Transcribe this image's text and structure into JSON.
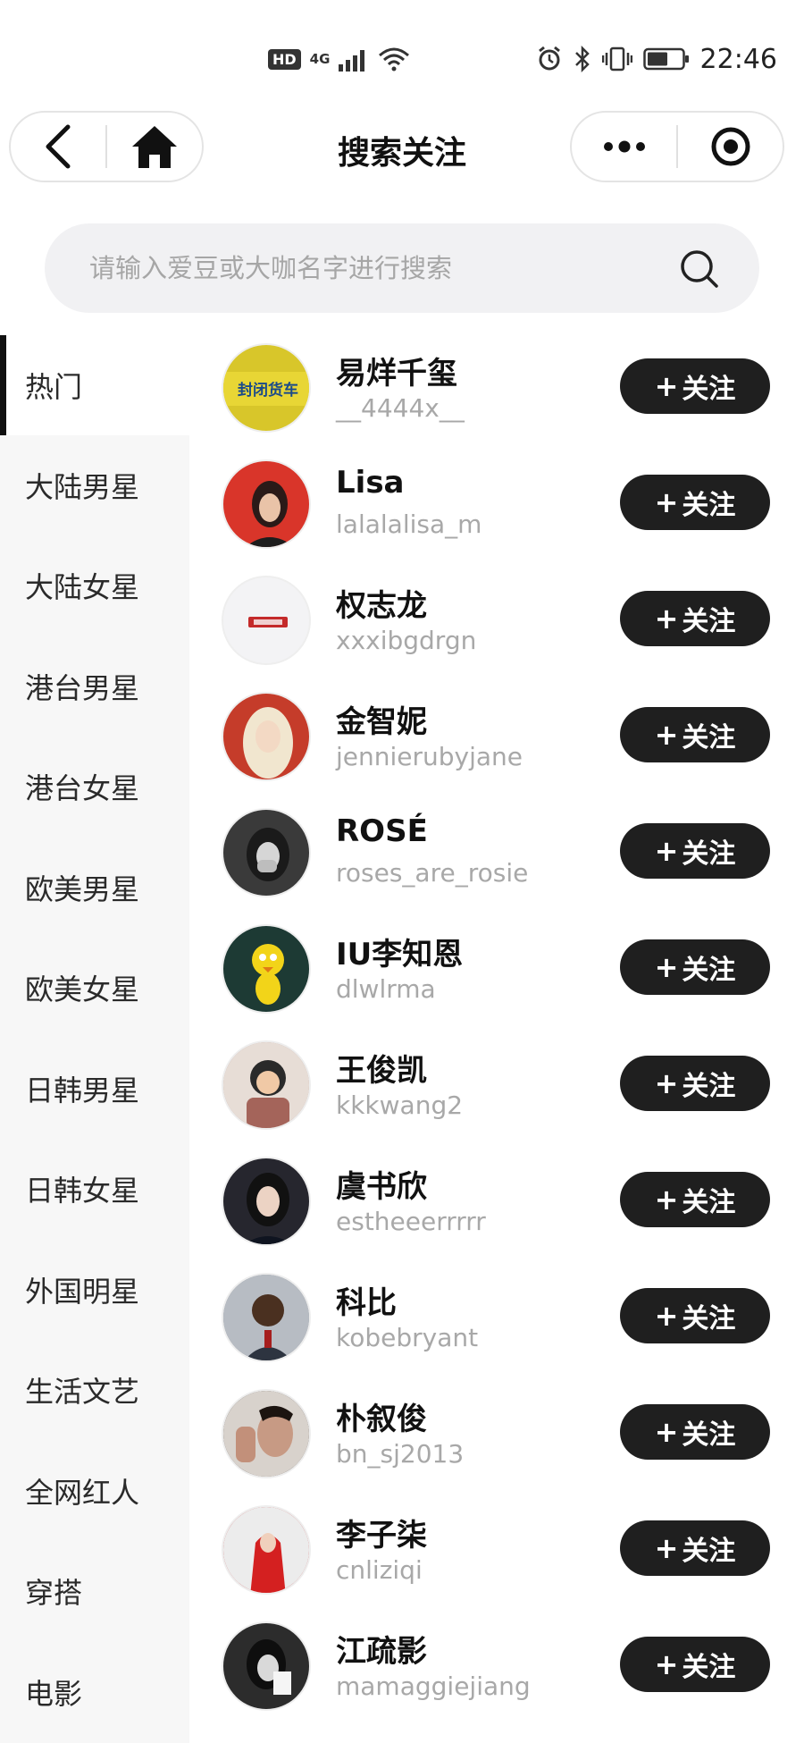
{
  "status_bar": {
    "hd": "HD",
    "network": "4G",
    "time": "22:46"
  },
  "nav": {
    "title": "搜索关注"
  },
  "search": {
    "placeholder": "请输入爱豆或大咖名字进行搜索"
  },
  "sidebar": {
    "items": [
      {
        "label": "热门",
        "active": true
      },
      {
        "label": "大陆男星"
      },
      {
        "label": "大陆女星"
      },
      {
        "label": "港台男星"
      },
      {
        "label": "港台女星"
      },
      {
        "label": "欧美男星"
      },
      {
        "label": "欧美女星"
      },
      {
        "label": "日韩男星"
      },
      {
        "label": "日韩女星"
      },
      {
        "label": "外国明星"
      },
      {
        "label": "生活文艺"
      },
      {
        "label": "全网红人"
      },
      {
        "label": "穿搭"
      },
      {
        "label": "电影"
      }
    ]
  },
  "follow_label": "关注",
  "users": [
    {
      "name": "易烊千玺",
      "handle": "__4444x__",
      "avatar_text": "封闭货车",
      "avatar_color": "#d8c62a"
    },
    {
      "name": "Lisa",
      "handle": "lalalalisa_m",
      "avatar_color": "#d9352a"
    },
    {
      "name": "权志龙",
      "handle": "xxxibgdrgn",
      "avatar_color": "#f3f3f5"
    },
    {
      "name": "金智妮",
      "handle": "jennierubyjane",
      "avatar_color": "#c53c2a"
    },
    {
      "name": "ROSÉ",
      "handle": "roses_are_rosie",
      "avatar_color": "#3a3a3a"
    },
    {
      "name": "IU李知恩",
      "handle": "dlwlrma",
      "avatar_color": "#1d3a34"
    },
    {
      "name": "王俊凯",
      "handle": "kkkwang2",
      "avatar_color": "#b9948a"
    },
    {
      "name": "虞书欣",
      "handle": "estheeerrrrr",
      "avatar_color": "#26262e"
    },
    {
      "name": "科比",
      "handle": "kobebryant",
      "avatar_color": "#8a8f96"
    },
    {
      "name": "朴叙俊",
      "handle": "bn_sj2013",
      "avatar_color": "#3b302c"
    },
    {
      "name": "李子柒",
      "handle": "cnliziqi",
      "avatar_color": "#c72a2a"
    },
    {
      "name": "江疏影",
      "handle": "mamaggiejiang",
      "avatar_color": "#2c2c2c"
    }
  ]
}
